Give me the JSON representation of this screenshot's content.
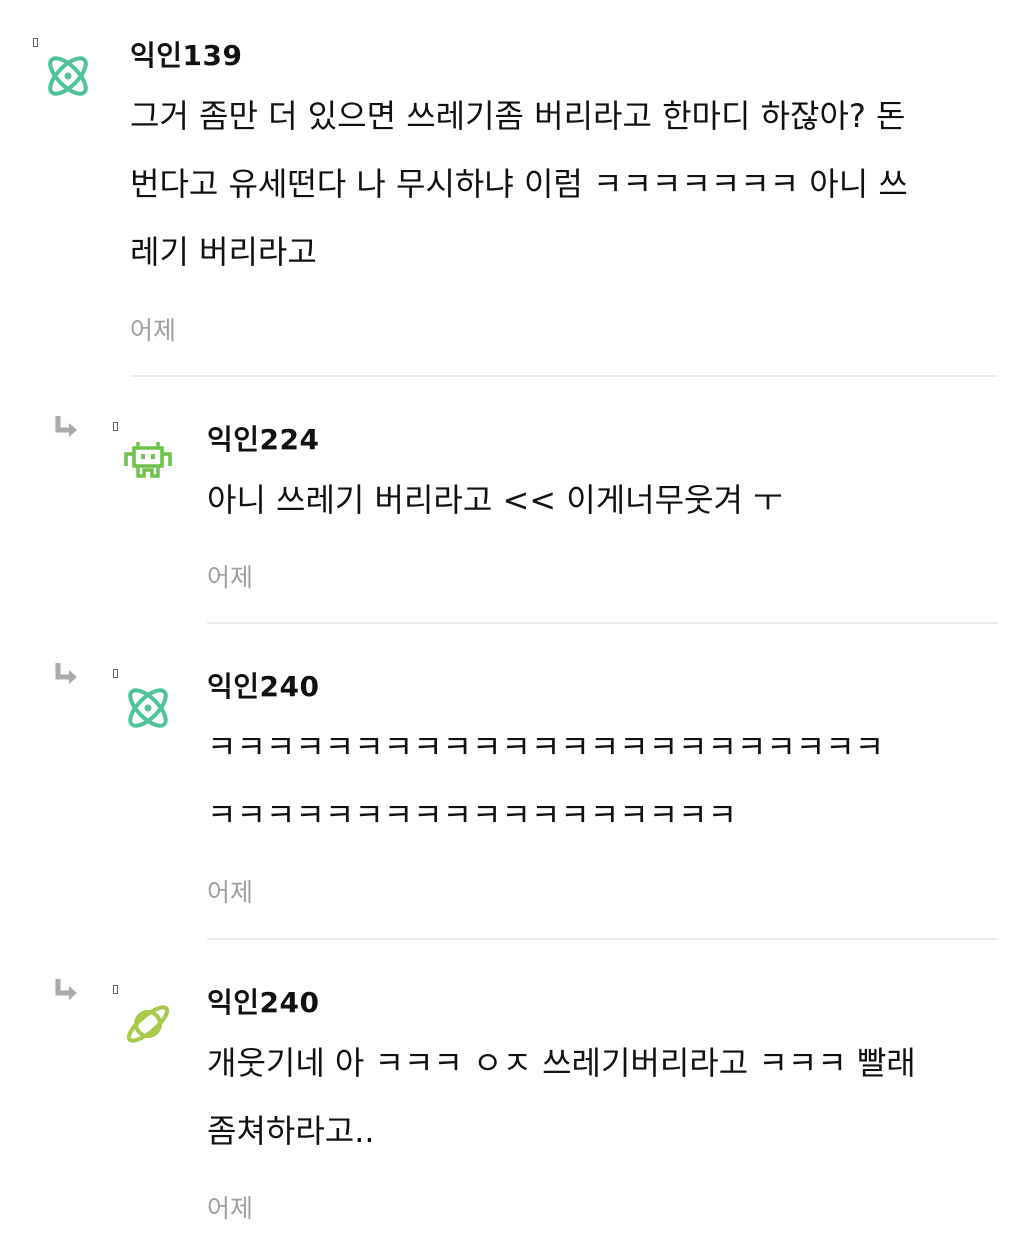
{
  "comments": [
    {
      "nickname": "익인139",
      "avatar_icon": "atom-icon",
      "avatar_color": "#4fc49a",
      "lines": [
        "그거 좀만 더 있으면 쓰레기좀 버리라고 한마디 하잖아? 돈",
        "번다고 유세떤다 나 무시하냐 이럼 ㅋㅋㅋㅋㅋㅋㅋ 아니 쓰",
        "레기 버리라고"
      ],
      "time": "어제",
      "is_reply": false
    },
    {
      "nickname": "익인224",
      "avatar_icon": "space-invader-icon",
      "avatar_color": "#6cc24a",
      "lines": [
        "아니 쓰레기 버리라고 << 이게너무웃겨 ㅜ"
      ],
      "time": "어제",
      "is_reply": true
    },
    {
      "nickname": "익인240",
      "avatar_icon": "atom-icon",
      "avatar_color": "#4fc49a",
      "lines": [
        "ㅋㅋㅋㅋㅋㅋㅋㅋㅋㅋㅋㅋㅋㅋㅋㅋㅋㅋㅋㅋㅋㅋㅋ",
        "ㅋㅋㅋㅋㅋㅋㅋㅋㅋㅋㅋㅋㅋㅋㅋㅋㅋㅋ"
      ],
      "time": "어제",
      "is_reply": true
    },
    {
      "nickname": "익인240",
      "avatar_icon": "planet-icon",
      "avatar_color": "#a6c94a",
      "lines": [
        "개웃기네 아 ㅋㅋㅋ ㅇㅈ 쓰레기버리라고 ㅋㅋㅋ 빨래",
        "좀쳐하라고.."
      ],
      "time": "어제",
      "is_reply": true
    }
  ]
}
